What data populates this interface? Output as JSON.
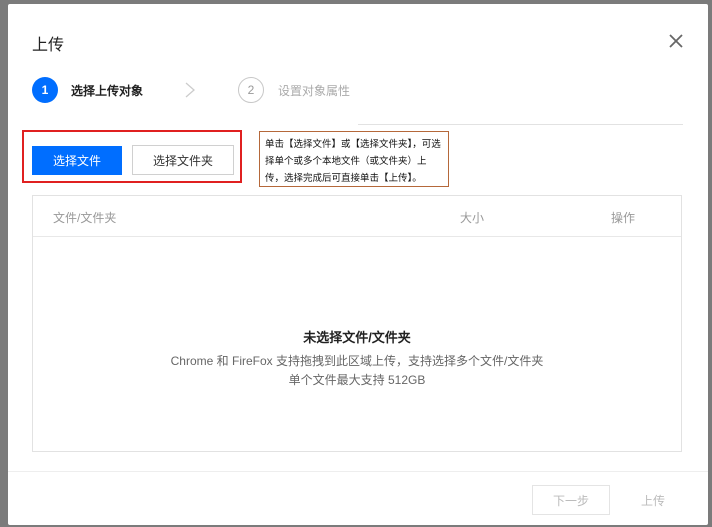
{
  "modal": {
    "title": "上传",
    "close_icon": "close-icon"
  },
  "steps": [
    {
      "number": "1",
      "label": "选择上传对象",
      "active": true
    },
    {
      "number": "2",
      "label": "设置对象属性",
      "active": false
    }
  ],
  "actions": {
    "select_file": "选择文件",
    "select_folder": "选择文件夹"
  },
  "note": {
    "text": "单击【选择文件】或【选择文件夹】，可选择单个或多个本地文件（或文件夹）上传，选择完成后可直接单击【上传】。"
  },
  "table": {
    "columns": [
      "文件/文件夹",
      "大小",
      "操作"
    ],
    "empty": {
      "title": "未选择文件/文件夹",
      "line1": "Chrome 和 FireFox 支持拖拽到此区域上传，支持选择多个文件/文件夹",
      "line2": "单个文件最大支持 512GB"
    }
  },
  "footer": {
    "next": "下一步",
    "upload": "上传"
  },
  "colors": {
    "primary": "#006eff",
    "highlight": "#e02020",
    "note_border": "#b5683a"
  }
}
